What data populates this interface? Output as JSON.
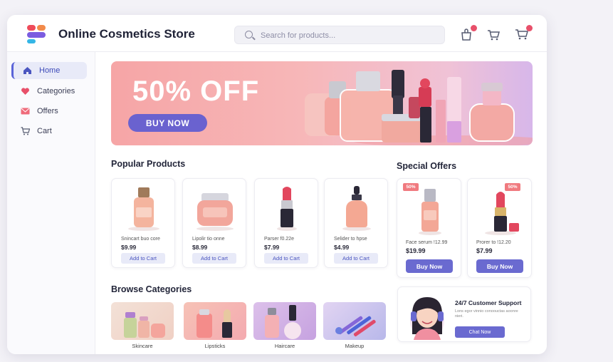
{
  "header": {
    "title": "Online Cosmetics Store",
    "search_placeholder": "Search for products...",
    "icons": [
      "bag-icon",
      "basket-icon",
      "cart-icon"
    ]
  },
  "sidebar": {
    "items": [
      {
        "label": "Home",
        "icon": "home-icon",
        "active": true
      },
      {
        "label": "Categories",
        "icon": "heart-icon",
        "active": false
      },
      {
        "label": "Offers",
        "icon": "mail-icon",
        "active": false
      },
      {
        "label": "Cart",
        "icon": "cart-icon",
        "active": false
      }
    ]
  },
  "banner": {
    "headline": "50% OFF",
    "button_label": "BUY NOW"
  },
  "popular": {
    "title": "Popular Products",
    "products": [
      {
        "name": "Snincart buo core",
        "price": "$9.99",
        "button": "Add to Cart"
      },
      {
        "name": "Lipolir tio onne",
        "price": "$8.99",
        "button": "Add to Cart"
      },
      {
        "name": "Parser f0.22e",
        "price": "$7.99",
        "button": "Add to Cart"
      },
      {
        "name": "Selider to hpse",
        "price": "$4.99",
        "button": "Add to Cart"
      }
    ]
  },
  "offers": {
    "title": "Special Offers",
    "items": [
      {
        "tag": "50%",
        "name": "Face serum !12.99",
        "price": "$19.99",
        "button": "Buy Now"
      },
      {
        "tag": "50%",
        "name": "Prorer to !12.20",
        "price": "$7.99",
        "button": "Buy Now"
      }
    ]
  },
  "categories": {
    "title": "Browse Categories",
    "items": [
      {
        "label": "Skincare"
      },
      {
        "label": "Lipsticks"
      },
      {
        "label": "Haircare"
      },
      {
        "label": "Makeup"
      }
    ]
  },
  "support": {
    "title": "24/7 Customer Support",
    "text": "Lons egor vinnio conoouctas aoonre nieri.",
    "button": "Chat Now"
  },
  "colors": {
    "accent": "#6a62cf",
    "banner_pink": "#f6a5a6",
    "badge": "#e8506a"
  }
}
